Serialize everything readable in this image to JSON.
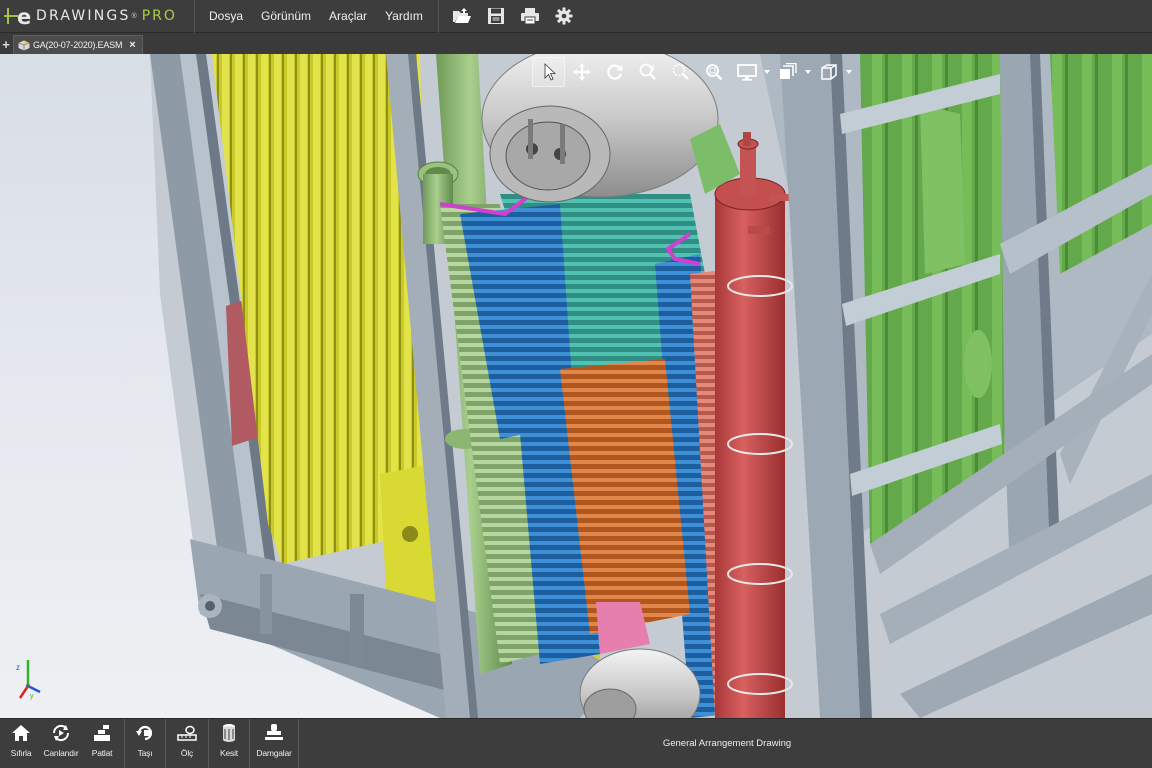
{
  "app": {
    "brand": "DRAWINGS",
    "brand_sup": "®",
    "brand_edition": "PRO",
    "accent_color": "#a9cf46"
  },
  "menu": {
    "items": [
      {
        "label": "Dosya"
      },
      {
        "label": "Görünüm"
      },
      {
        "label": "Araçlar"
      },
      {
        "label": "Yardım"
      }
    ]
  },
  "quick_tools": [
    {
      "icon": "open-folder-icon"
    },
    {
      "icon": "save-icon"
    },
    {
      "icon": "print-icon"
    },
    {
      "icon": "gear-icon"
    }
  ],
  "tabs": {
    "add_label": "+",
    "documents": [
      {
        "label": "GA(20-07-2020).EASM",
        "close": "×",
        "icon": "assembly-icon"
      }
    ]
  },
  "view_tools": [
    {
      "icon": "select-arrow-icon",
      "active": true
    },
    {
      "icon": "pan-icon"
    },
    {
      "icon": "rotate-icon"
    },
    {
      "icon": "zoom-in-out-icon"
    },
    {
      "icon": "zoom-area-icon"
    },
    {
      "icon": "zoom-fit-icon"
    },
    {
      "icon": "display-mode-icon"
    },
    {
      "icon": "styles-icon"
    },
    {
      "icon": "views-cube-icon"
    }
  ],
  "bottom_toolbar": {
    "groups": [
      [
        {
          "label": "Sıfırla",
          "icon": "home-icon"
        },
        {
          "label": "Canlandır",
          "icon": "animate-icon"
        },
        {
          "label": "Patlat",
          "icon": "explode-icon"
        }
      ],
      [
        {
          "label": "Taşı",
          "icon": "move-icon"
        }
      ],
      [
        {
          "label": "Ölç",
          "icon": "measure-icon"
        }
      ],
      [
        {
          "label": "Kesit",
          "icon": "section-icon"
        }
      ],
      [
        {
          "label": "Damgalar",
          "icon": "stamp-icon"
        }
      ]
    ],
    "document_title": "General Arrangement Drawing"
  }
}
